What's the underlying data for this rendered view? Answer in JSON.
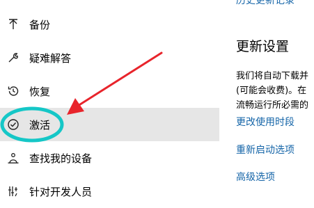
{
  "sidebar": {
    "items": [
      {
        "label": "备份",
        "icon": "backup-icon"
      },
      {
        "label": "疑难解答",
        "icon": "wrench-icon"
      },
      {
        "label": "恢复",
        "icon": "history-icon"
      },
      {
        "label": "激活",
        "icon": "check-circle-icon",
        "active": true
      },
      {
        "label": "查找我的设备",
        "icon": "person-pin-icon"
      },
      {
        "label": "针对开发人员",
        "icon": "developer-icon"
      }
    ]
  },
  "main": {
    "history_link": "历史更新记录",
    "section_title": "更新设置",
    "description_lines": [
      "我们将自动下载并",
      "(可能会收费)。在",
      "流畅运行所必需的"
    ],
    "links": [
      "更改使用时段",
      "重新启动选项",
      "高级选项"
    ]
  },
  "colors": {
    "link": "#1565a8",
    "active_bg": "#e6e6e6",
    "annotation_circle": "#15c7c7",
    "annotation_arrow": "#e8242b"
  }
}
